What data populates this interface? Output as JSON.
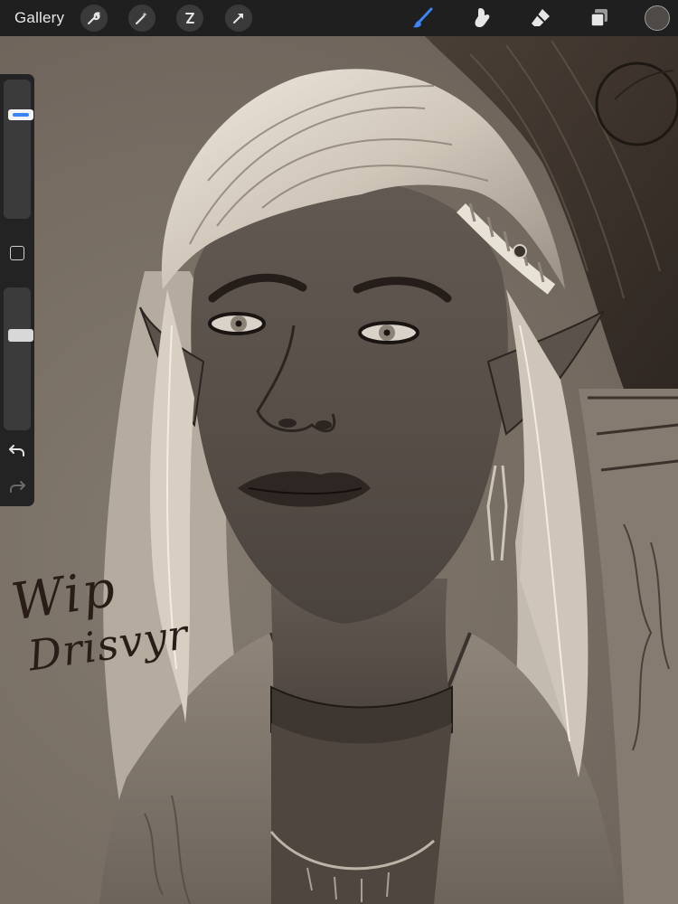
{
  "topbar": {
    "gallery_label": "Gallery",
    "left_tools": [
      "wrench-icon",
      "magic-wand-icon",
      "selection-icon",
      "transform-arrow-icon"
    ],
    "right_tools": [
      "brush-icon",
      "smudge-icon",
      "eraser-icon",
      "layers-icon"
    ],
    "active_tool": "brush",
    "accent_color": "#3b83f7",
    "current_color": "#4e4a46"
  },
  "sidebar": {
    "brush_size_level": 0.77,
    "opacity_level": 0.68,
    "modify_button": "square-modifier-icon",
    "undo": "undo-icon",
    "redo": "redo-icon",
    "redo_enabled": false
  },
  "canvas": {
    "handwritten_text": [
      "Wip",
      "Drisvyr"
    ]
  }
}
